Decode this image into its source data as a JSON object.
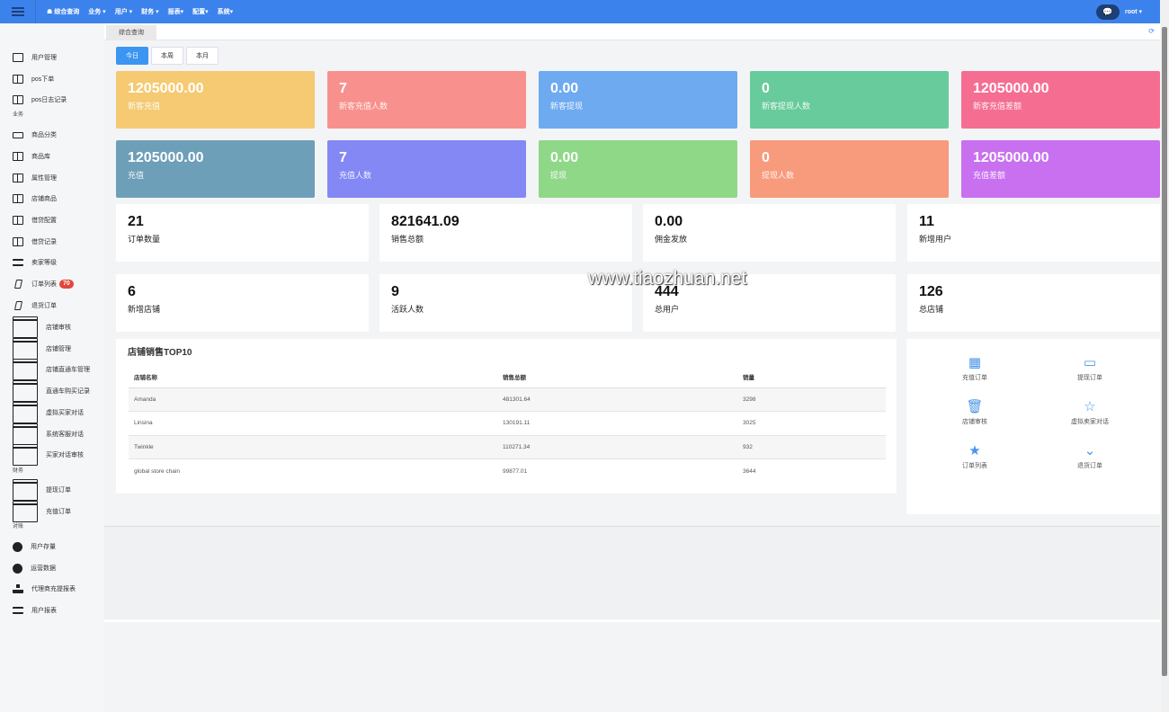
{
  "topbar": {
    "nav": [
      "综合查询",
      "业务 ▾",
      "用户 ▾",
      "财务 ▾",
      "报表▾",
      "配置▾",
      "系统▾"
    ],
    "user": "root ▾",
    "chat_icon": "comments-icon"
  },
  "tabs": {
    "active": "综合查询"
  },
  "sidebar": {
    "sections": [
      "业务",
      "财务",
      "对账"
    ],
    "items": [
      {
        "label": "用户管理",
        "icon": "file"
      },
      {
        "label": "pos下单",
        "icon": "book"
      },
      {
        "label": "pos日志记录",
        "icon": "book"
      },
      {
        "label": "商品分类",
        "icon": "laptop"
      },
      {
        "label": "商品库",
        "icon": "book"
      },
      {
        "label": "属性管理",
        "icon": "book"
      },
      {
        "label": "店铺商品",
        "icon": "book"
      },
      {
        "label": "借贷配置",
        "icon": "book"
      },
      {
        "label": "借贷记录",
        "icon": "book"
      },
      {
        "label": "卖家等级",
        "icon": "indent"
      },
      {
        "label": "订单列表",
        "icon": "tablet",
        "badge": "70"
      },
      {
        "label": "退货订单",
        "icon": "tablet"
      },
      {
        "label": "店铺审核",
        "icon": "card"
      },
      {
        "label": "店铺管理",
        "icon": "card"
      },
      {
        "label": "店铺直通车管理",
        "icon": "card"
      },
      {
        "label": "直通车购买记录",
        "icon": "card"
      },
      {
        "label": "虚拟买家对话",
        "icon": "card"
      },
      {
        "label": "系统客服对话",
        "icon": "card"
      },
      {
        "label": "买家对话审核",
        "icon": "card"
      },
      {
        "label": "提现订单",
        "icon": "card"
      },
      {
        "label": "充值订单",
        "icon": "card"
      },
      {
        "label": "用户存量",
        "icon": "pie"
      },
      {
        "label": "运营数据",
        "icon": "pie"
      },
      {
        "label": "代理商充提报表",
        "icon": "sitemap"
      },
      {
        "label": "用户报表",
        "icon": "lines"
      }
    ]
  },
  "filters": [
    "今日",
    "本周",
    "本月"
  ],
  "color_cards": [
    {
      "value": "1205000.00",
      "label": "新客充值",
      "color": "#f5ca72"
    },
    {
      "value": "7",
      "label": "新客充值人数",
      "color": "#f8918d"
    },
    {
      "value": "0.00",
      "label": "新客提现",
      "color": "#6eaaef"
    },
    {
      "value": "0",
      "label": "新客提现人数",
      "color": "#68cb9c"
    },
    {
      "value": "1205000.00",
      "label": "新客充值差额",
      "color": "#f56e92"
    },
    {
      "value": "1205000.00",
      "label": "充值",
      "color": "#6e9fb9"
    },
    {
      "value": "7",
      "label": "充值人数",
      "color": "#8388f5"
    },
    {
      "value": "0.00",
      "label": "提现",
      "color": "#8fd888"
    },
    {
      "value": "0",
      "label": "提现人数",
      "color": "#f89a7c"
    },
    {
      "value": "1205000.00",
      "label": "充值差额",
      "color": "#c870f0"
    }
  ],
  "stat_cards": [
    {
      "value": "21",
      "label": "订单数量"
    },
    {
      "value": "821641.09",
      "label": "销售总额"
    },
    {
      "value": "0.00",
      "label": "佣金发放"
    },
    {
      "value": "11",
      "label": "新增用户"
    },
    {
      "value": "6",
      "label": "新增店铺"
    },
    {
      "value": "9",
      "label": "活跃人数"
    },
    {
      "value": "444",
      "label": "总用户"
    },
    {
      "value": "126",
      "label": "总店铺"
    }
  ],
  "top10": {
    "title": "店铺销售TOP10",
    "headers": [
      "店铺名称",
      "销售总额",
      "销量"
    ],
    "rows": [
      [
        "Amanda",
        "481301.64",
        "3298"
      ],
      [
        "Linsina",
        "130191.11",
        "3025"
      ],
      [
        "Twinkle",
        "110271.34",
        "932"
      ],
      [
        "global store chain",
        "99877.01",
        "3644"
      ]
    ]
  },
  "quick_links": [
    {
      "label": "充值订单",
      "icon": "qrcode-icon"
    },
    {
      "label": "提现订单",
      "icon": "credit-card-icon"
    },
    {
      "label": "店铺审核",
      "icon": "trash-icon"
    },
    {
      "label": "虚拟卖家对话",
      "icon": "star-outline-icon"
    },
    {
      "label": "订单列表",
      "icon": "star-icon"
    },
    {
      "label": "退货订单",
      "icon": "chevron-down-icon"
    }
  ],
  "watermark": "www.tiaozhuan.net"
}
